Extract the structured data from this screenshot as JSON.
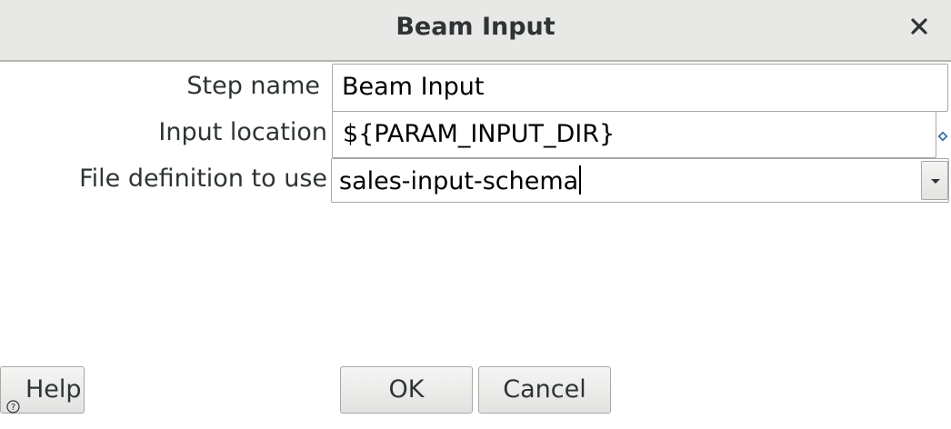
{
  "dialog": {
    "title": "Beam Input"
  },
  "form": {
    "step_name": {
      "label": "Step name",
      "value": "Beam Input"
    },
    "input_location": {
      "label": "Input location",
      "value": "${PARAM_INPUT_DIR}",
      "variable_icon": "variable-diamond-icon"
    },
    "file_definition": {
      "label": "File definition to use",
      "value": "sales-input-schema",
      "dropdown_icon": "chevron-down-icon"
    }
  },
  "buttons": {
    "help": "Help",
    "ok": "OK",
    "cancel": "Cancel"
  },
  "icons": {
    "close": "close-icon",
    "help": "help-icon"
  },
  "colors": {
    "titlebar_bg": "#e8e8e7",
    "variable_icon": "#3d6fa6"
  }
}
